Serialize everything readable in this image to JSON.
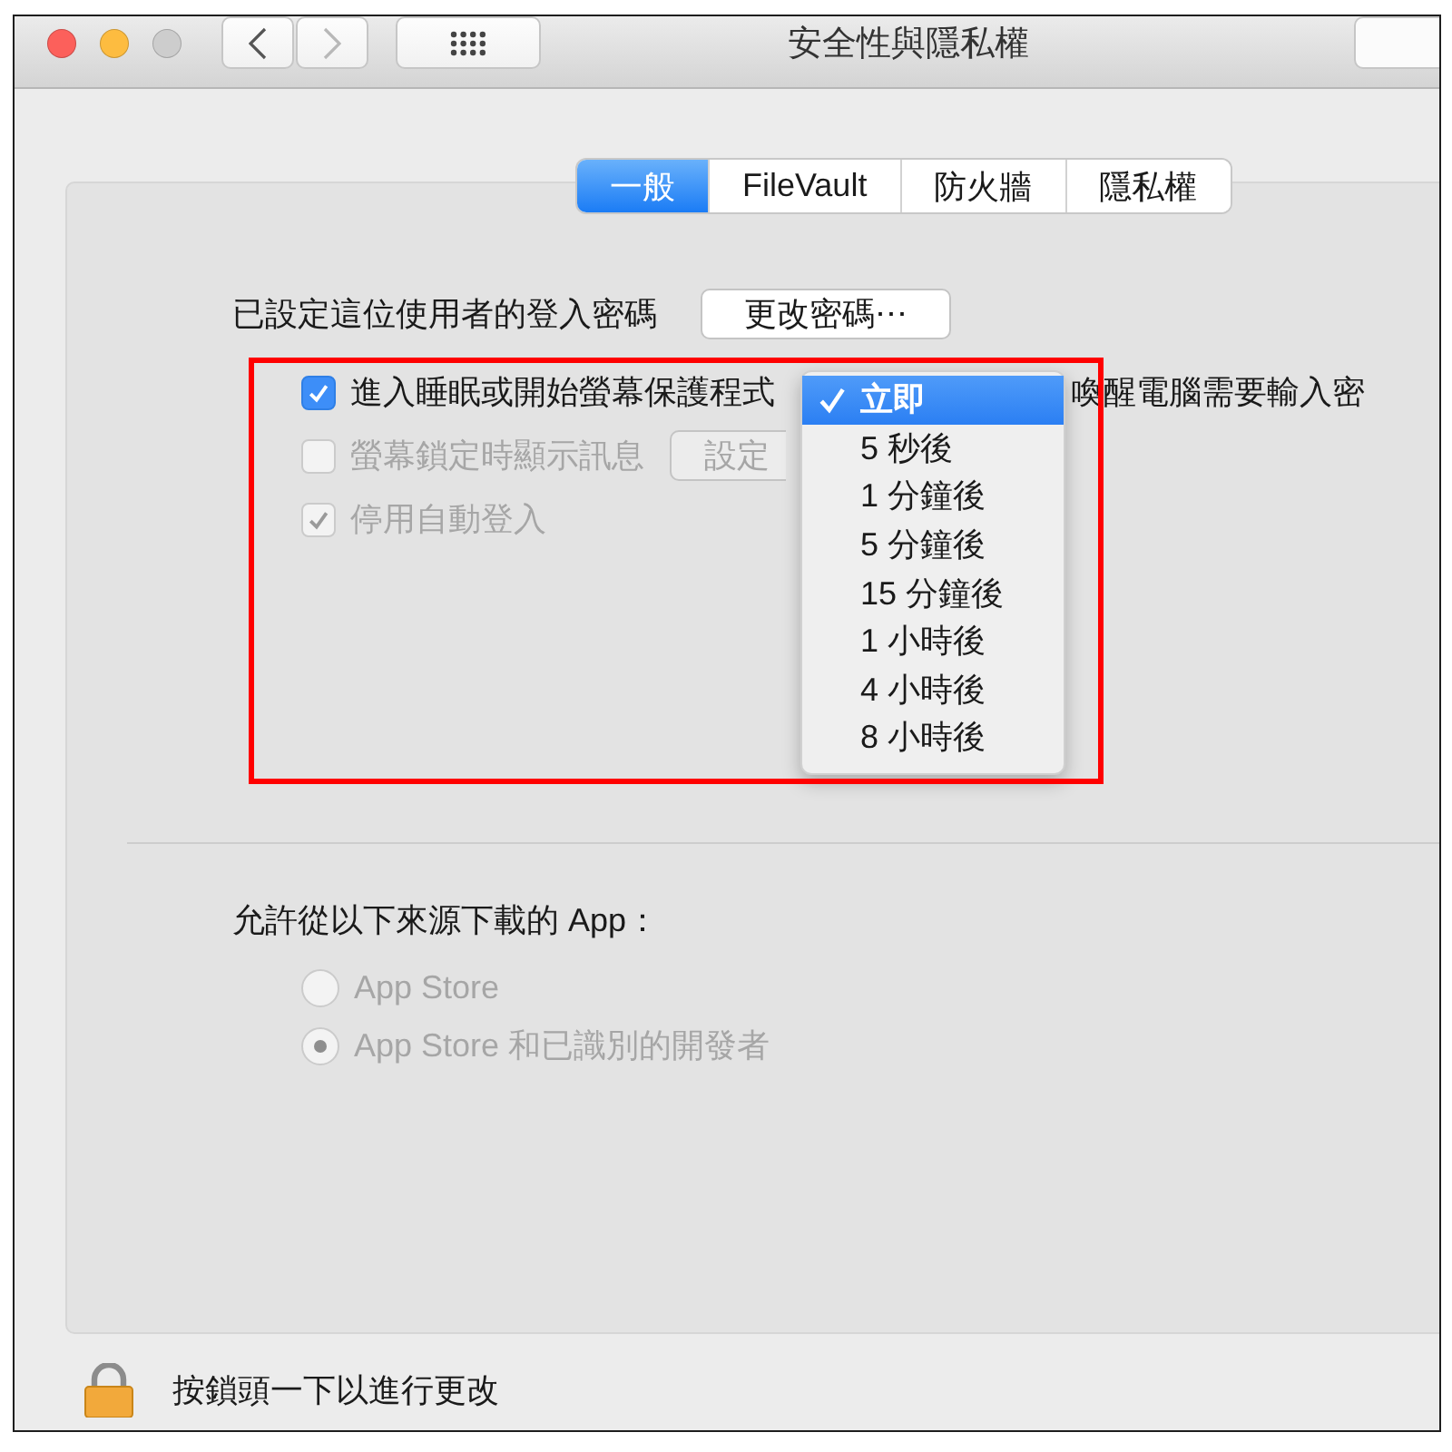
{
  "window": {
    "title": "安全性與隱私權",
    "controls": [
      {
        "kind": "close",
        "disabled": false
      },
      {
        "kind": "minimize",
        "disabled": false
      },
      {
        "kind": "zoom",
        "disabled": true
      }
    ]
  },
  "toolbar": {
    "nav": [
      {
        "kind": "back",
        "disabled": false
      },
      {
        "kind": "forward",
        "disabled": true
      }
    ]
  },
  "tabs": [
    {
      "label": "一般",
      "selected": true
    },
    {
      "label": "FileVault",
      "selected": false
    },
    {
      "label": "防火牆",
      "selected": false
    },
    {
      "label": "隱私權",
      "selected": false
    }
  ],
  "password": {
    "label": "已設定這位使用者的登入密碼",
    "button": "更改密碼⋯"
  },
  "options": [
    {
      "kind": "popup",
      "label": "進入睡眠或開始螢幕保護程式",
      "checked": true,
      "disabled": false,
      "after": "喚醒電腦需要輸入密"
    },
    {
      "kind": "button",
      "label": "螢幕鎖定時顯示訊息",
      "checked": false,
      "disabled": true,
      "button": "設定"
    },
    {
      "kind": "plain",
      "label": "停用自動登入",
      "checked": true,
      "disabled": true
    }
  ],
  "popup_menu": [
    {
      "label": "立即",
      "selected": true
    },
    {
      "label": "5 秒後",
      "selected": false
    },
    {
      "label": "1 分鐘後",
      "selected": false
    },
    {
      "label": "5 分鐘後",
      "selected": false
    },
    {
      "label": "15 分鐘後",
      "selected": false
    },
    {
      "label": "1 小時後",
      "selected": false
    },
    {
      "label": "4 小時後",
      "selected": false
    },
    {
      "label": "8 小時後",
      "selected": false
    }
  ],
  "downloads": {
    "label": "允許從以下來源下載的 App：",
    "options": [
      {
        "label": "App Store",
        "selected": false,
        "disabled": true
      },
      {
        "label": "App Store 和已識別的開發者",
        "selected": true,
        "disabled": true
      }
    ]
  },
  "lock": {
    "label": "按鎖頭一下以進行更改"
  }
}
